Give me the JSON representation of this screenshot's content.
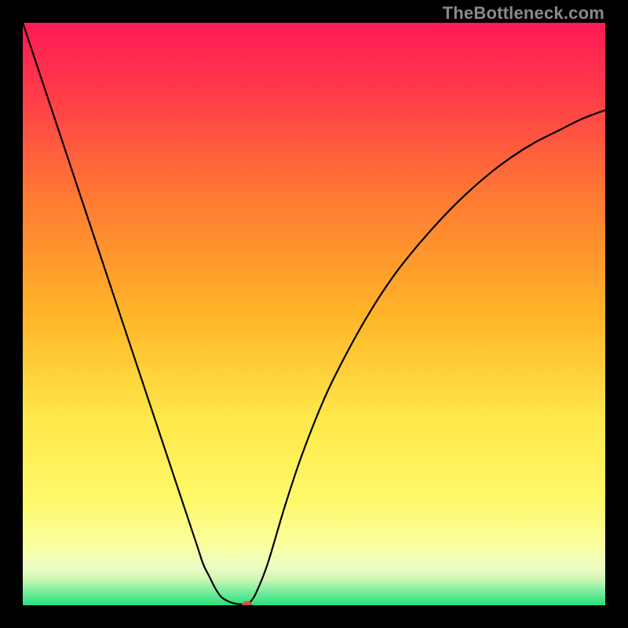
{
  "watermark": "TheBottleneck.com",
  "chart_data": {
    "type": "line",
    "title": "",
    "xlabel": "",
    "ylabel": "",
    "xlim": [
      0,
      100
    ],
    "ylim": [
      0,
      100
    ],
    "grid": false,
    "legend": false,
    "background": {
      "style": "vertical-gradient",
      "description": "Smooth vertical gradient from pink-red at top through orange and yellow to light-yellow near bottom, with a thin green band at the very bottom.",
      "stops": [
        {
          "pos": 0.0,
          "color": "#ff1a55"
        },
        {
          "pos": 0.12,
          "color": "#ff3a49"
        },
        {
          "pos": 0.3,
          "color": "#ff7a33"
        },
        {
          "pos": 0.5,
          "color": "#ffb428"
        },
        {
          "pos": 0.68,
          "color": "#ffe84a"
        },
        {
          "pos": 0.82,
          "color": "#fff96a"
        },
        {
          "pos": 0.9,
          "color": "#f8ffa0"
        },
        {
          "pos": 0.935,
          "color": "#eefcc4"
        },
        {
          "pos": 0.955,
          "color": "#cef7b5"
        },
        {
          "pos": 0.975,
          "color": "#7feea0"
        },
        {
          "pos": 1.0,
          "color": "#27e07d"
        }
      ]
    },
    "series": [
      {
        "name": "bottleneck-curve",
        "color": "#000000",
        "stroke_width": 2.2,
        "x": [
          0,
          2,
          4,
          6,
          8,
          10,
          12,
          14,
          16,
          18,
          20,
          22,
          24,
          26,
          28,
          30,
          31,
          32,
          33,
          34,
          35,
          36,
          37,
          38,
          38.5,
          39,
          40,
          42,
          45,
          48,
          52,
          56,
          60,
          64,
          68,
          72,
          76,
          80,
          84,
          88,
          92,
          96,
          100
        ],
        "values": [
          100,
          94,
          88,
          82,
          76,
          70,
          64,
          58,
          52,
          46,
          40,
          34,
          28,
          22,
          16,
          10,
          7,
          5,
          3,
          1.5,
          0.8,
          0.4,
          0.2,
          0.1,
          0.05,
          0.5,
          2,
          7,
          17,
          26,
          36,
          44,
          51,
          57,
          62,
          66.5,
          70.5,
          74,
          77,
          79.5,
          81.5,
          83.5,
          85
        ]
      }
    ],
    "marker": {
      "name": "minimum-point",
      "x": 38.5,
      "y": 0.05,
      "color": "#d0524f",
      "rx": 6.5,
      "ry": 5
    }
  }
}
